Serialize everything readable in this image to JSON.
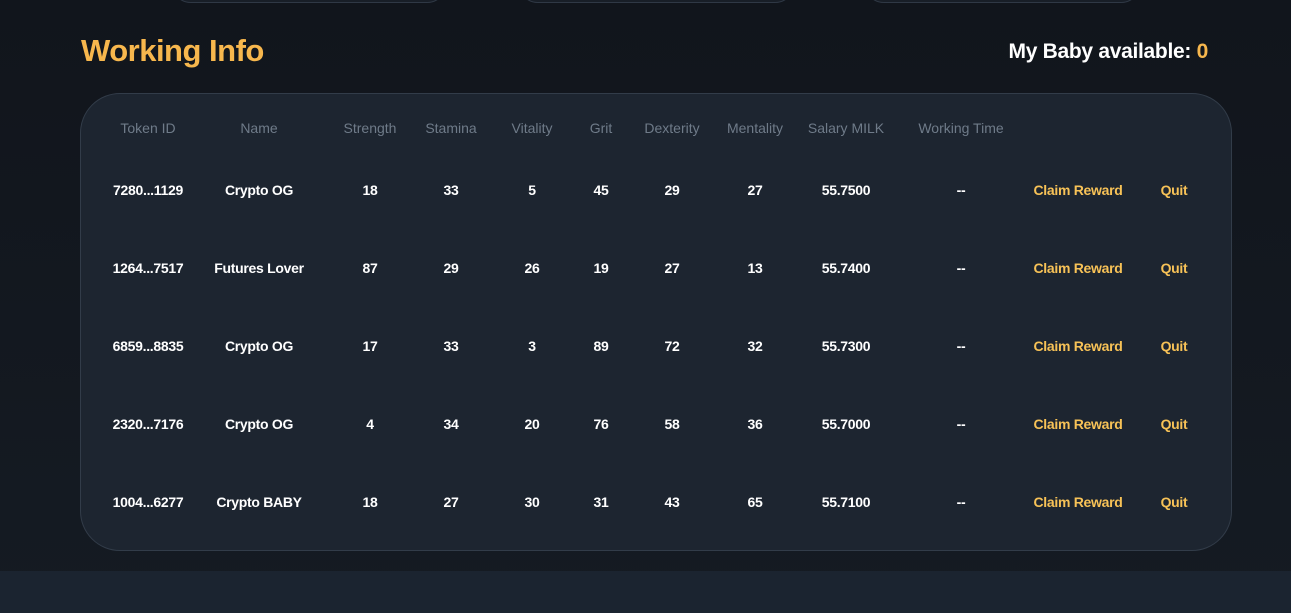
{
  "header": {
    "title": "Working Info",
    "available_label": "My Baby available:",
    "available_count": "0"
  },
  "table": {
    "columns": [
      "Token ID",
      "Name",
      "Strength",
      "Stamina",
      "Vitality",
      "Grit",
      "Dexterity",
      "Mentality",
      "Salary MILK",
      "Working Time"
    ],
    "claim_label": "Claim Reward",
    "quit_label": "Quit",
    "rows": [
      {
        "token_id": "7280...1129",
        "name": "Crypto OG",
        "strength": "18",
        "stamina": "33",
        "vitality": "5",
        "grit": "45",
        "dexterity": "29",
        "mentality": "27",
        "salary": "55.7500",
        "working_time": "--"
      },
      {
        "token_id": "1264...7517",
        "name": "Futures Lover",
        "strength": "87",
        "stamina": "29",
        "vitality": "26",
        "grit": "19",
        "dexterity": "27",
        "mentality": "13",
        "salary": "55.7400",
        "working_time": "--"
      },
      {
        "token_id": "6859...8835",
        "name": "Crypto OG",
        "strength": "17",
        "stamina": "33",
        "vitality": "3",
        "grit": "89",
        "dexterity": "72",
        "mentality": "32",
        "salary": "55.7300",
        "working_time": "--"
      },
      {
        "token_id": "2320...7176",
        "name": "Crypto OG",
        "strength": "4",
        "stamina": "34",
        "vitality": "20",
        "grit": "76",
        "dexterity": "58",
        "mentality": "36",
        "salary": "55.7000",
        "working_time": "--"
      },
      {
        "token_id": "1004...6277",
        "name": "Crypto BABY",
        "strength": "18",
        "stamina": "27",
        "vitality": "30",
        "grit": "31",
        "dexterity": "43",
        "mentality": "65",
        "salary": "55.7100",
        "working_time": "--"
      }
    ]
  },
  "colors": {
    "accent": "#f7b74d",
    "action": "#f7c257",
    "panel_bg": "#1d2530",
    "page_bg": "#131820",
    "header_text": "#6f7b89"
  }
}
